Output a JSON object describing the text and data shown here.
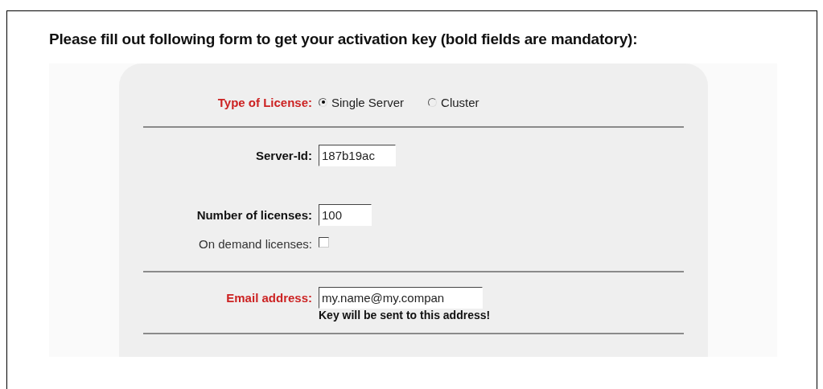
{
  "heading": "Please fill out following form to get your activation key (bold fields are mandatory):",
  "rows": [
    {
      "kind": "radio",
      "label": "Type of License:",
      "required": true,
      "options": [
        {
          "label": "Single Server",
          "selected": true
        },
        {
          "label": "Cluster",
          "selected": false
        }
      ]
    },
    {
      "kind": "rule"
    },
    {
      "kind": "text",
      "label": "Server-Id:",
      "bold": true,
      "value": "187b19ac"
    },
    {
      "kind": "spacer"
    },
    {
      "kind": "text",
      "label": "Number of licenses:",
      "bold": true,
      "value": "100"
    },
    {
      "kind": "checkbox",
      "label": "On demand licenses:",
      "bold": false,
      "checked": false
    },
    {
      "kind": "rule"
    },
    {
      "kind": "text",
      "label": "Email address:",
      "required": true,
      "value": "my.name@my.compan",
      "note": "Key will be sent to this address!"
    },
    {
      "kind": "rule"
    }
  ]
}
